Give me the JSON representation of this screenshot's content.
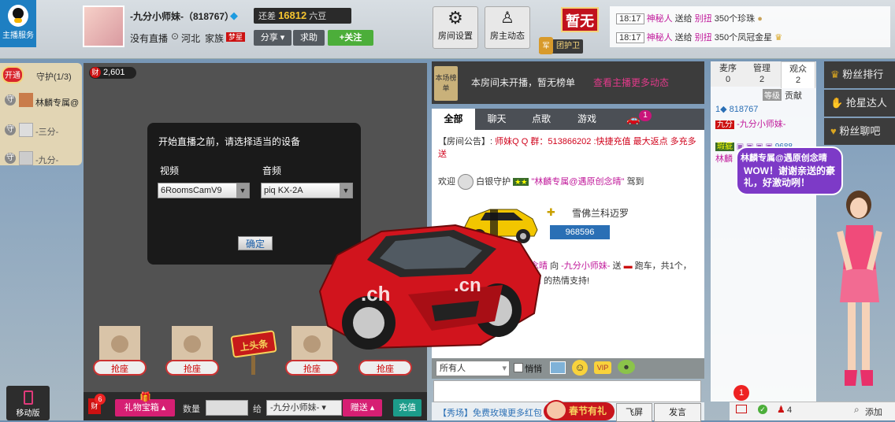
{
  "header": {
    "logo_label": "主播服务",
    "anchor_name": "-九分小师妹-（818767）",
    "gap_label": "还差",
    "gap_value": "16812",
    "gap_unit": "六豆",
    "no_live": "没有直播",
    "location": "河北",
    "family_label": "家族",
    "family_badge": "梦星",
    "share_label": "分享",
    "help_label": "求助",
    "follow_label": "+关注",
    "room_settings": "房间设置",
    "owner_news": "房主动态",
    "zanwu": "暂无",
    "guard_label": "团护卫"
  },
  "notifications": [
    {
      "time": "18:17",
      "who": "神秘人",
      "verb": "送给",
      "target": "别扭",
      "gift": "350个珍珠"
    },
    {
      "time": "18:17",
      "who": "神秘人",
      "verb": "送给",
      "target": "别扭",
      "gift": "350个凤冠金星"
    }
  ],
  "guard_panel": {
    "open_label": "开通",
    "title": "守护(1/3)",
    "members": [
      "林麟专属@",
      "-三分-",
      "-九分-"
    ]
  },
  "stage": {
    "wealth_count": "2,601",
    "dialog_title": "开始直播之前，请选择适当的设备",
    "video_label": "视频",
    "audio_label": "音频",
    "video_value": "6RoomsCamV9",
    "audio_value": "piq KX-2A",
    "ok_label": "确定",
    "seat_label": "抢座",
    "headline_label": "上头条",
    "mobile_label": "移动版"
  },
  "ranking": {
    "badge": "本场榜单",
    "text": "本房间未开播，暂无榜单",
    "link": "查看主播更多动态"
  },
  "chat_tabs": [
    "全部",
    "聊天",
    "点歌",
    "游戏"
  ],
  "chat_tab_badge": "1",
  "chat": {
    "announce_prefix": "【房间公告】:",
    "announce_text": "师妹Q Q 群：513866202 :快捷充值 最大返点 多充多送",
    "welcome_prefix": "欢迎",
    "welcome_guard": "白银守护",
    "welcome_user": "\"林麟专属@遇原创念晴\"",
    "welcome_suffix": "驾到",
    "car_name": "雪佛兰科迈罗",
    "car_id": "968596",
    "gift_line_user": "遇原创念晴",
    "gift_line_mid": "向",
    "gift_line_target": "-九分小师妹-",
    "gift_line_verb": "送",
    "gift_line_gift": "跑车，共1个，",
    "gift_line_thanks": "晴",
    "gift_line_end": "的热情支持!"
  },
  "chat_input": {
    "target": "所有人",
    "whisper": "悄悄",
    "fly_label": "飞屏",
    "send_label": "发言",
    "promo": "【秀场】免费玫瑰更多红包",
    "spring_label": "春节有礼"
  },
  "gift_bar": {
    "gift_box": "礼物宝箱",
    "qty_label": "数量",
    "to_label": "给",
    "to_value": "-九分小师妹-",
    "send_label": "赠送",
    "recharge_label": "充值",
    "wealth_badge": "6"
  },
  "audience": {
    "tabs": [
      {
        "label": "麦序",
        "count": "0"
      },
      {
        "label": "管理",
        "count": "2"
      },
      {
        "label": "观众",
        "count": "2"
      }
    ],
    "rank_label": "等级",
    "contrib_label": "贡献",
    "users": [
      {
        "id": "818767",
        "name": "-九分小师妹-",
        "badge": "九分"
      },
      {
        "id": "9688",
        "name": "林麟",
        "badge": "瑕疵"
      }
    ]
  },
  "side_menu": [
    "粉丝排行",
    "抢星达人",
    "粉丝聊吧"
  ],
  "bubble": {
    "title": "林麟专属@遇原创念晴",
    "text": "WOW！谢谢亲送的豪礼，好激动咧！"
  },
  "footer": {
    "mail_badge": "1",
    "people_count": "4",
    "add_label": "添加"
  },
  "colors": {
    "accent_red": "#d0021b",
    "accent_pink": "#c0189a",
    "accent_blue": "#2a6fb5",
    "green": "#4cae3a"
  }
}
